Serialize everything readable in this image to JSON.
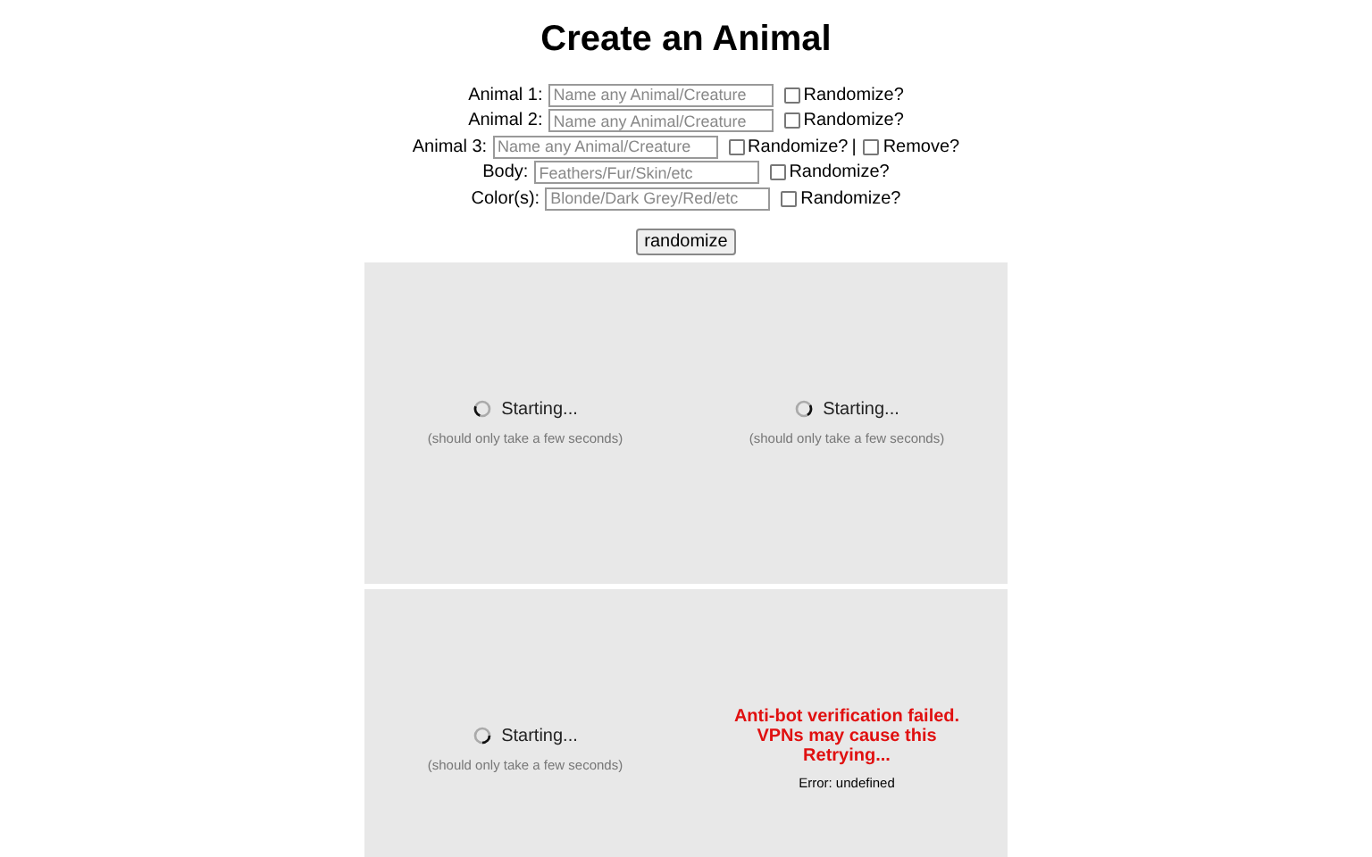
{
  "title": "Create an Animal",
  "fields": [
    {
      "label": "Animal 1:",
      "placeholder": "Name any Animal/Creature",
      "options": [
        {
          "label": "Randomize?",
          "checked": false
        }
      ]
    },
    {
      "label": "Animal 2:",
      "placeholder": "Name any Animal/Creature",
      "options": [
        {
          "label": "Randomize?",
          "checked": false
        }
      ]
    },
    {
      "label": "Animal 3:",
      "placeholder": "Name any Animal/Creature",
      "options": [
        {
          "label": "Randomize?",
          "checked": false
        },
        {
          "prefix": "|",
          "label": "Remove?",
          "checked": false
        }
      ]
    },
    {
      "label": "Body:",
      "placeholder": "Feathers/Fur/Skin/etc",
      "options": [
        {
          "label": "Randomize?",
          "checked": false
        }
      ]
    },
    {
      "label": "Color(s):",
      "placeholder": "Blonde/Dark Grey/Red/etc",
      "options": [
        {
          "label": "Randomize?",
          "checked": false
        }
      ]
    }
  ],
  "button": "randomize",
  "rows": [
    {
      "cells": [
        {
          "kind": "loading",
          "status": "Starting...",
          "note": "(should only take a few seconds)"
        },
        {
          "kind": "loading",
          "status": "Starting...",
          "note": "(should only take a few seconds)"
        }
      ]
    },
    {
      "cells": [
        {
          "kind": "loading",
          "status": "Starting...",
          "note": "(should only take a few seconds)"
        },
        {
          "kind": "error",
          "lines": [
            "Anti-bot verification failed.",
            "VPNs may cause this",
            "Retrying..."
          ],
          "detail": "Error: undefined"
        }
      ]
    }
  ]
}
